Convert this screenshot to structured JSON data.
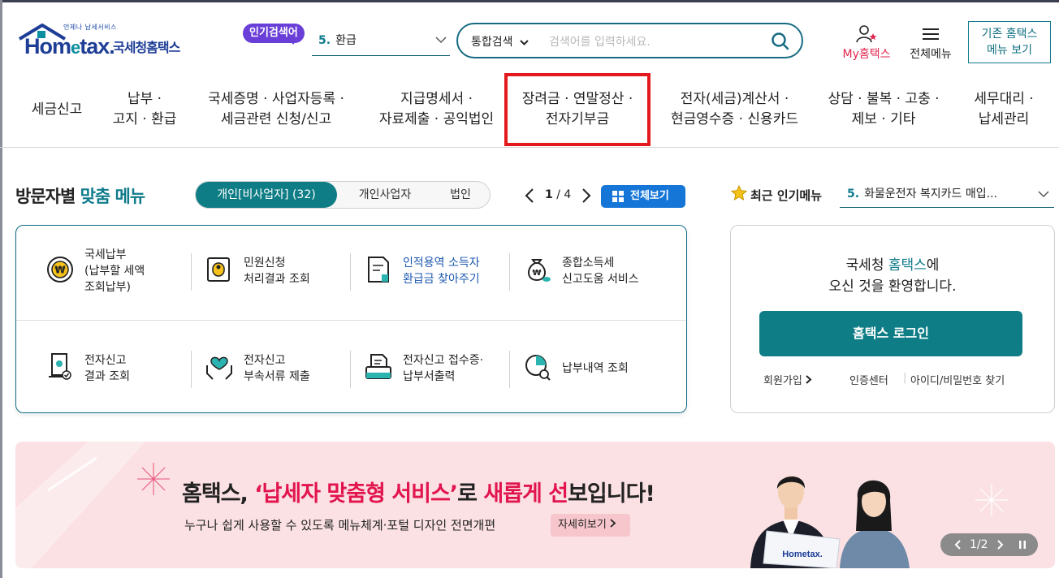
{
  "header": {
    "logo_tag": "언제나 납세서비스",
    "logo_main": "Hom",
    "logo_e": "e",
    "logo_tax": "tax.",
    "logo_kr": "국세청홈택스",
    "popular_label": "인기검색어",
    "hot_rank": "5.",
    "hot_term": "환급",
    "search_scope": "통합검색",
    "search_placeholder": "검색어를 입력하세요.",
    "my_label": "My홈택스",
    "allmenu_label": "전체메뉴",
    "old_menu_line1": "기존 홈택스",
    "old_menu_line2": "메뉴 보기"
  },
  "nav": [
    {
      "label": "세금신고"
    },
    {
      "label": "납부 ·\n고지 · 환급"
    },
    {
      "label": "국세증명 · 사업자등록 ·\n세금관련 신청/신고"
    },
    {
      "label": "지급명세서 ·\n자료제출 · 공익법인"
    },
    {
      "label": "장려금 · 연말정산 ·\n전자기부금"
    },
    {
      "label": "전자(세금)계산서 ·\n현금영수증 · 신용카드"
    },
    {
      "label": "상담 · 불복 · 고충 ·\n제보 · 기타"
    },
    {
      "label": "세무대리 ·\n납세관리"
    }
  ],
  "visitor": {
    "title_a": "방문자별 ",
    "title_b": "맞춤 메뉴",
    "tabs": [
      "개인[비사업자] (32)",
      "개인사업자",
      "법인"
    ],
    "page_current": "1",
    "page_sep": " / ",
    "page_total": "4",
    "full_view": "전체보기",
    "items": [
      {
        "label": "국세납부\n(납부할 세액\n조회납부)",
        "icon": "tax-payment-icon"
      },
      {
        "label": "민원신청\n처리결과 조회",
        "icon": "civil-petition-icon"
      },
      {
        "label": "인적용역 소득자\n환급금 찾아주기",
        "icon": "refund-document-icon"
      },
      {
        "label": "종합소득세\n신고도움 서비스",
        "icon": "money-bag-icon"
      },
      {
        "label": "전자신고\n결과 조회",
        "icon": "e-filing-result-icon"
      },
      {
        "label": "전자신고\n부속서류 제출",
        "icon": "heart-hands-icon"
      },
      {
        "label": "전자신고 접수증·\n납부서출력",
        "icon": "printer-icon"
      },
      {
        "label": "납부내역 조회",
        "icon": "pie-chart-search-icon"
      }
    ]
  },
  "recent": {
    "label": "최근 인기메뉴",
    "rank": "5.",
    "term": "화물운전자 복지카드 매입..."
  },
  "login": {
    "welcome_a": "국세청 ",
    "welcome_b": "홈택스",
    "welcome_c": "에",
    "welcome_line2": "오신 것을 환영합니다.",
    "button": "홈택스 로그인",
    "join": "회원가입",
    "cert": "인증센터",
    "find": "아이디/비밀번호 찾기"
  },
  "banner": {
    "head_a": "홈택스, ",
    "head_b": "‘납세자 맞춤형 서비스’",
    "head_c": "로 ",
    "head_d": "새롭게 선",
    "head_e": "보입니다!",
    "sub": "누구나 쉽게 사용할 수 있도록 메뉴체계·포털 디자인 전면개편",
    "more": "자세히보기",
    "page": "1/2",
    "laptop_logo": "Hometax."
  },
  "colors": {
    "teal": "#0e7d86",
    "navy": "#1d3d96",
    "highlight_red": "#e3191d",
    "pink_bg": "#fbe1e3",
    "banner_red": "#e2144e",
    "blue_button": "#1576d8"
  }
}
